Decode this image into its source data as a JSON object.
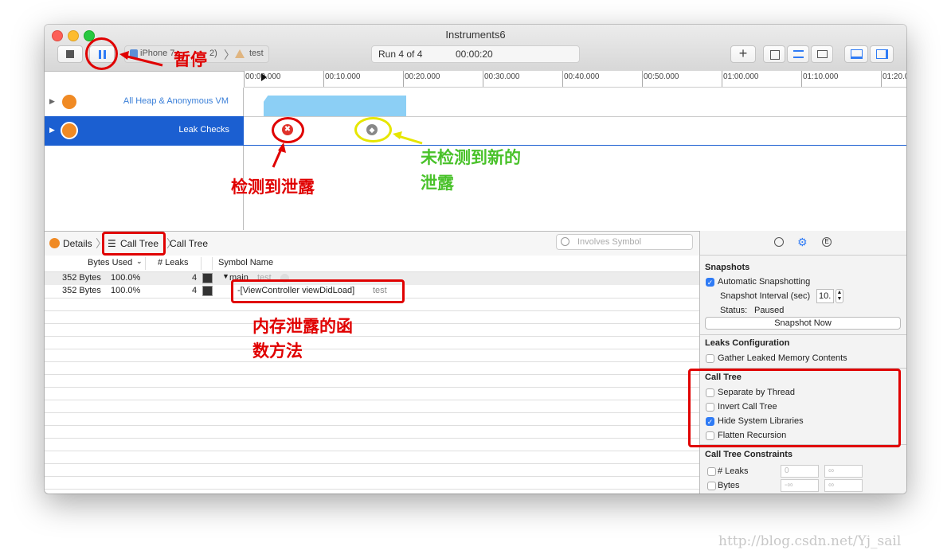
{
  "window": {
    "title": "Instruments6"
  },
  "toolbar": {
    "breadcrumb_device": "iPhone 7",
    "breadcrumb_device_suffix": "2)",
    "breadcrumb_app": "test",
    "run_label": "Run 4 of 4",
    "run_time": "00:00:20",
    "add_label": "+"
  },
  "timeline": {
    "ticks": [
      "00:00.000",
      "00:10.000",
      "00:20.000",
      "00:30.000",
      "00:40.000",
      "00:50.000",
      "01:00.000",
      "01:10.000",
      "01:20.0"
    ]
  },
  "tracks": [
    {
      "name": "All Heap & Anonymous VM"
    },
    {
      "name": "Leak Checks"
    }
  ],
  "detail_bar": {
    "details": "Details",
    "call_tree_1": "Call Tree",
    "call_tree_2": "Call Tree",
    "search_placeholder": "Involves Symbol"
  },
  "table": {
    "columns": [
      "Bytes Used",
      "# Leaks",
      "Symbol Name"
    ],
    "rows": [
      {
        "bytes": "352 Bytes",
        "percent": "100.0%",
        "leaks": "4",
        "symbol": "main",
        "lib": "test"
      },
      {
        "bytes": "352 Bytes",
        "percent": "100.0%",
        "leaks": "4",
        "symbol": "-[ViewController viewDidLoad]",
        "lib": "test"
      }
    ]
  },
  "inspector": {
    "snapshots_title": "Snapshots",
    "auto_snapshot": "Automatic Snapshotting",
    "interval_label": "Snapshot Interval (sec)",
    "interval_value": "10.",
    "status_label": "Status:",
    "status_value": "Paused",
    "snapshot_now": "Snapshot Now",
    "leaks_config_title": "Leaks Configuration",
    "gather_contents": "Gather Leaked Memory Contents",
    "call_tree_title": "Call Tree",
    "separate_thread": "Separate by Thread",
    "invert_tree": "Invert Call Tree",
    "hide_system": "Hide System Libraries",
    "flatten": "Flatten Recursion",
    "constraints_title": "Call Tree Constraints",
    "c_leaks": "# Leaks",
    "c_bytes": "Bytes",
    "c_leaks_min": "0",
    "c_leaks_max": "∞",
    "c_bytes_min": "-∞",
    "c_bytes_max": "∞"
  },
  "annotations": {
    "pause": "暂停",
    "leak_detected": "检测到泄露",
    "no_new_leak_1": "未检测到新的",
    "no_new_leak_2": "泄露",
    "leak_function_1": "内存泄露的函",
    "leak_function_2": "数方法"
  },
  "watermark": "http://blog.csdn.net/Yj_sail",
  "colors": {
    "accent": "#2f7bf5",
    "annotation_red": "#e00000",
    "annotation_green": "#49c22a",
    "selected_track": "#1b5fd1",
    "heap_graph": "#8ccff5"
  }
}
